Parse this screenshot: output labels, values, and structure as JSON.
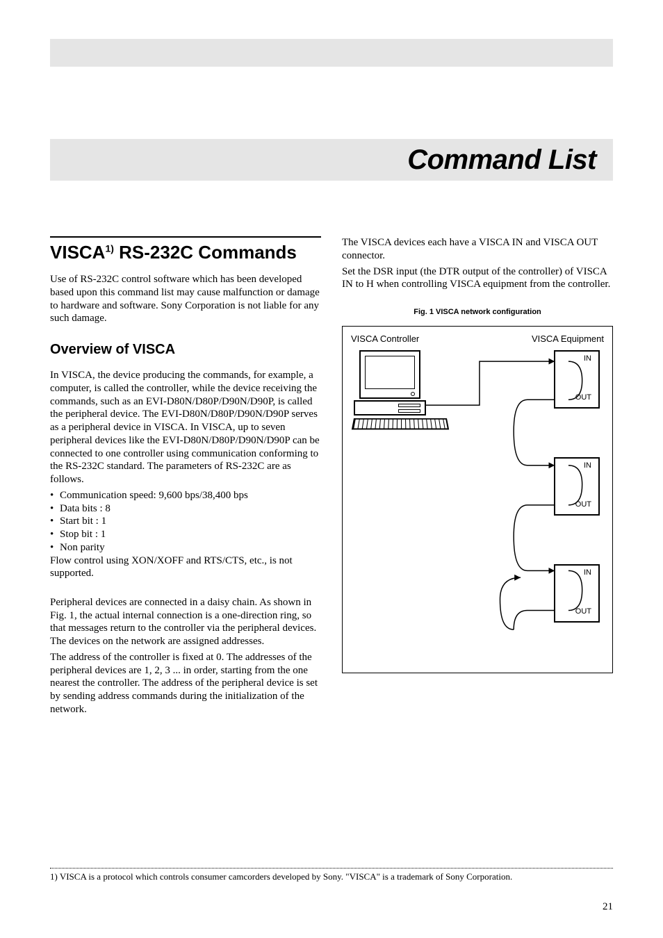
{
  "page_title": "Command List",
  "section_title_prefix": "VISCA",
  "section_title_sup": "1)",
  "section_title_rest": " RS-232C Commands",
  "intro_para": "Use of RS-232C control software which has been developed based upon this command list may cause malfunction or damage to hardware and software. Sony Corporation is not liable for any such damage.",
  "subhead": "Overview of VISCA",
  "overview_p1": "In VISCA, the device producing the commands, for example, a computer, is called the controller, while the device receiving the commands, such as an EVI-D80N/D80P/D90N/D90P, is called the peripheral device. The EVI-D80N/D80P/D90N/D90P serves as a peripheral device in VISCA. In VISCA, up to seven peripheral devices like the EVI-D80N/D80P/D90N/D90P can be connected to one controller using communication conforming to the RS-232C standard. The parameters of RS-232C are as follows.",
  "bullets": [
    "Communication speed: 9,600 bps/38,400 bps",
    "Data bits : 8",
    "Start bit : 1",
    "Stop bit : 1",
    "Non parity"
  ],
  "overview_p2": "Flow control using XON/XOFF and RTS/CTS, etc., is not supported.",
  "overview_p3": "Peripheral devices are connected in a daisy chain. As shown in Fig. 1, the actual internal connection is a one-direction ring, so that messages return to the controller via the peripheral devices. The devices on the network are assigned addresses.",
  "overview_p4": "The address of the controller is fixed at 0. The addresses of the peripheral devices are 1, 2, 3 ... in order, starting from the one nearest the controller. The address of the peripheral device is set by sending address commands during the initialization of the network.",
  "right_p1": "The VISCA devices each have a VISCA IN and VISCA OUT connector.",
  "right_p2": "Set the DSR input (the DTR output of the controller) of VISCA IN to H when controlling VISCA equipment from the controller.",
  "fig_caption": "Fig. 1 VISCA network configuration",
  "diagram": {
    "controller_label": "VISCA Controller",
    "equipment_label": "VISCA Equipment",
    "in_label": "IN",
    "out_label": "OUT"
  },
  "footnote": "1) VISCA is a protocol which controls consumer camcorders developed by Sony. \"VISCA\" is a trademark of Sony Corporation.",
  "page_number": "21"
}
